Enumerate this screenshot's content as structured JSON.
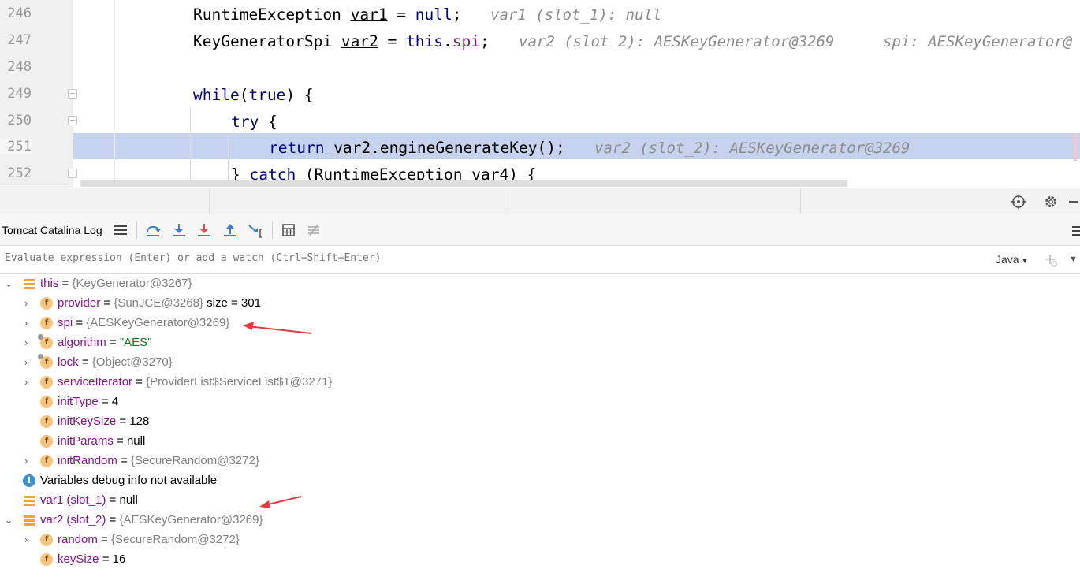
{
  "editor": {
    "lines": [
      {
        "num": "246",
        "code_a": "RuntimeException ",
        "var": "var1",
        "code_b": " = ",
        "kw": "null",
        "code_c": ";",
        "hint": "var1 (slot_1): null"
      },
      {
        "num": "247",
        "code_a": "KeyGeneratorSpi ",
        "var": "var2",
        "code_b": " = ",
        "kw": "this",
        "code_c": ".",
        "field": "spi",
        "code_d": ";",
        "hint": "var2 (slot_2): AESKeyGenerator@3269",
        "hint2": "spi: AESKeyGenerator@"
      },
      {
        "num": "248"
      },
      {
        "num": "249",
        "kw": "while",
        "code_a": "(",
        "kw2": "true",
        "code_b": ") {"
      },
      {
        "num": "250",
        "kw": "try",
        "code_a": " {"
      },
      {
        "num": "251",
        "kw": "return ",
        "var": "var2",
        "code_a": ".engineGenerateKey();",
        "hint": "var2 (slot_2): AESKeyGenerator@3269"
      },
      {
        "num": "252",
        "code_a": "} ",
        "kw": "catch",
        "code_b": " (RuntimeException var4) {"
      }
    ]
  },
  "toolbar": {
    "tab_label": "Tomcat Catalina Log",
    "colors": {
      "blue": "#3a7fd1",
      "red": "#e05252",
      "gray": "#6e6e6e"
    }
  },
  "eval": {
    "placeholder": "Evaluate expression (Enter) or add a watch (Ctrl+Shift+Enter)",
    "language": "Java"
  },
  "variables": {
    "this": {
      "name": "this",
      "eq": " = ",
      "value": "{KeyGenerator@3267}"
    },
    "provider": {
      "name": "provider",
      "eq": " = ",
      "value": "{SunJCE@3268}",
      "extra": " size = 301"
    },
    "spi": {
      "name": "spi",
      "eq": " = ",
      "value": "{AESKeyGenerator@3269}"
    },
    "algorithm": {
      "name": "algorithm",
      "eq": " = ",
      "value": "\"AES\""
    },
    "lock": {
      "name": "lock",
      "eq": " = ",
      "value": "{Object@3270}"
    },
    "serviceIterator": {
      "name": "serviceIterator",
      "eq": " = ",
      "value": "{ProviderList$ServiceList$1@3271}"
    },
    "initType": {
      "name": "initType",
      "eq": " = ",
      "value": "4"
    },
    "initKeySize": {
      "name": "initKeySize",
      "eq": " = ",
      "value": "128"
    },
    "initParams": {
      "name": "initParams",
      "eq": " = ",
      "value": "null"
    },
    "initRandom": {
      "name": "initRandom",
      "eq": " = ",
      "value": "{SecureRandom@3272}"
    },
    "info": "Variables debug info not available",
    "var1": {
      "name": "var1 (slot_1)",
      "eq": " = ",
      "value": "null"
    },
    "var2": {
      "name": "var2 (slot_2)",
      "eq": " = ",
      "value": "{AESKeyGenerator@3269}"
    },
    "random": {
      "name": "random",
      "eq": " = ",
      "value": "{SecureRandom@3272}"
    },
    "keySize": {
      "name": "keySize",
      "eq": " = ",
      "value": "16"
    }
  },
  "icons": {
    "field": "f",
    "info": "i"
  }
}
